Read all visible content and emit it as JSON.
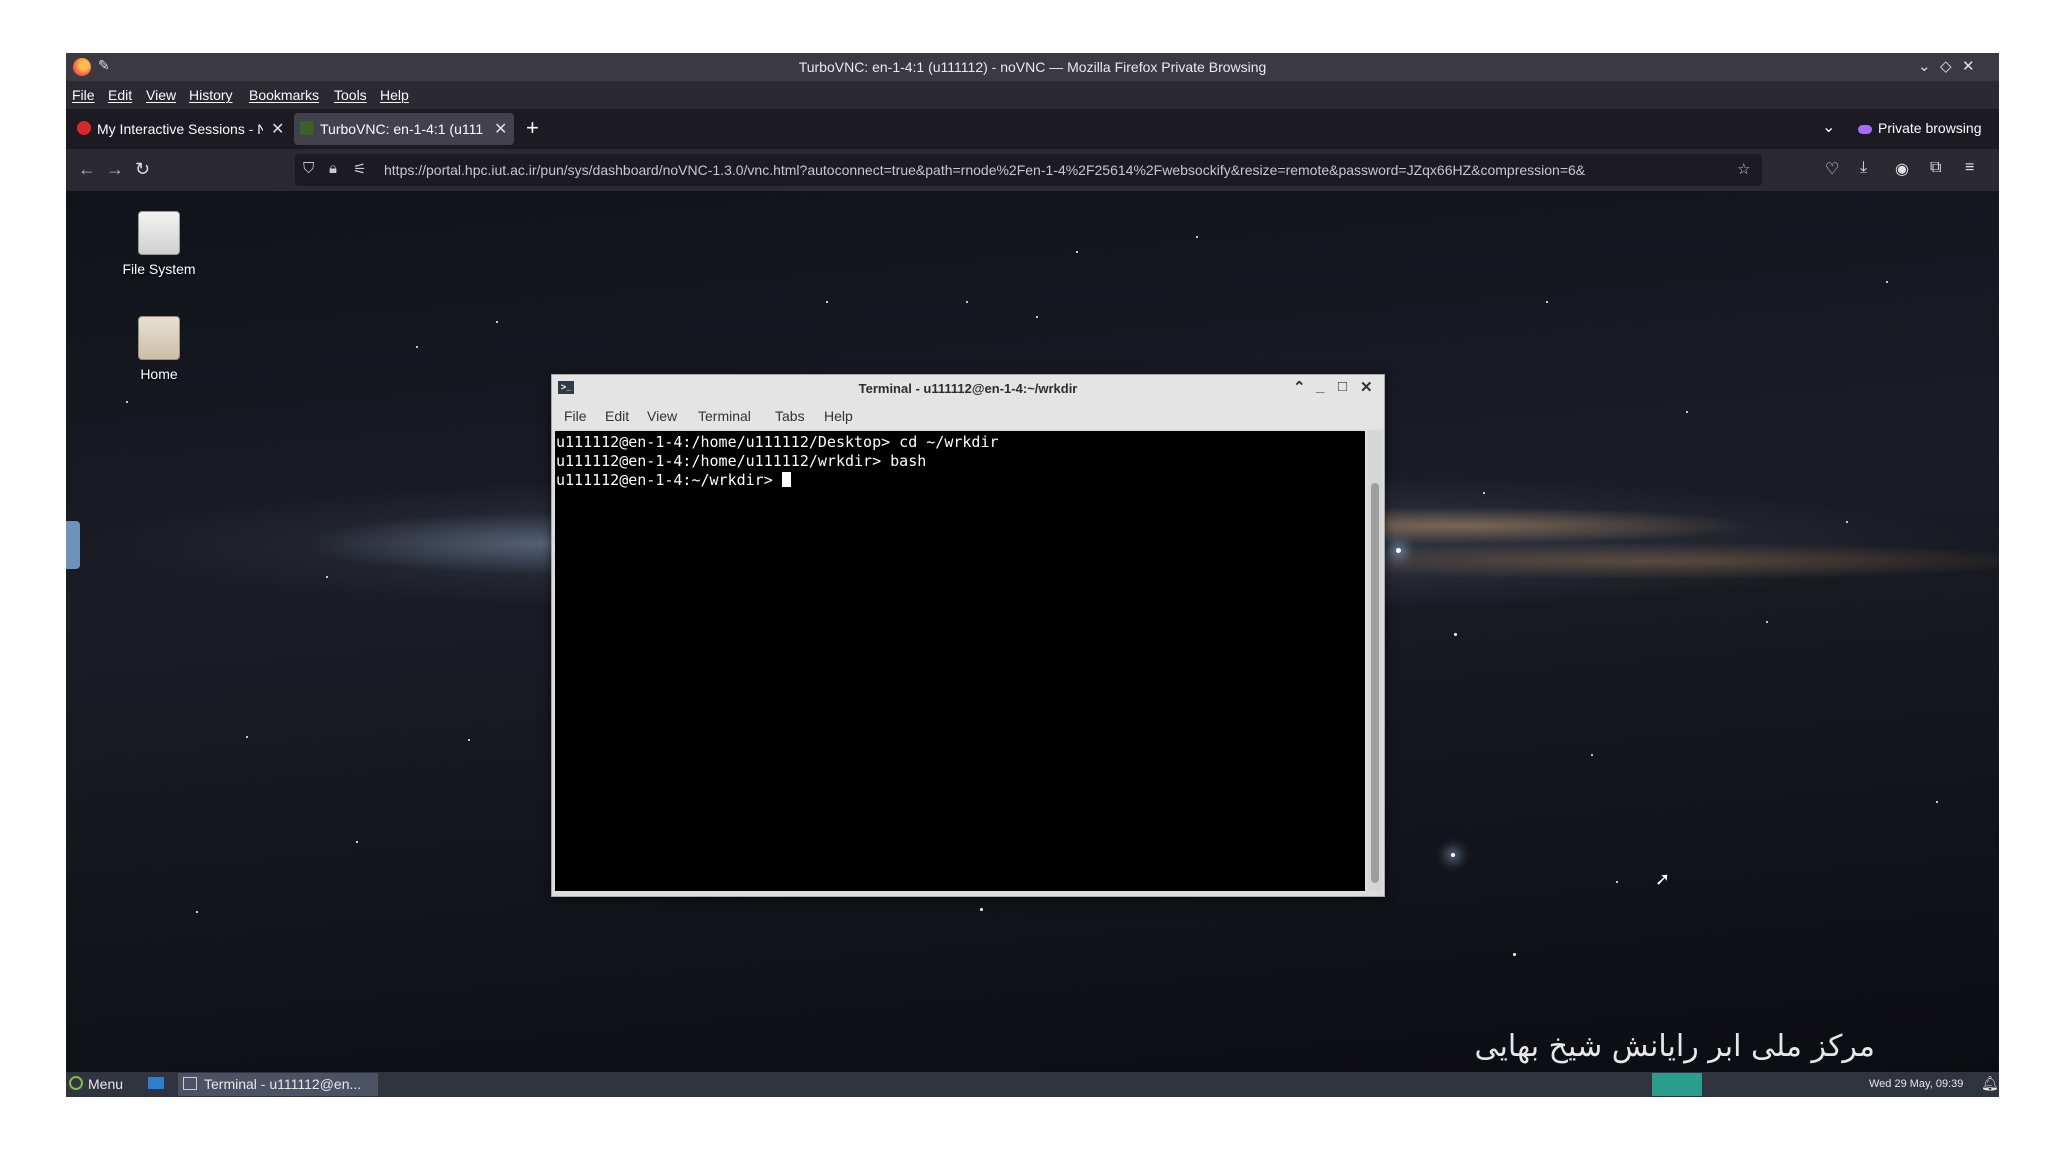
{
  "window": {
    "title": "TurboVNC: en-1-4:1 (u111112) - noVNC — Mozilla Firefox Private Browsing"
  },
  "menubar": [
    "File",
    "Edit",
    "View",
    "History",
    "Bookmarks",
    "Tools",
    "Help"
  ],
  "tabs": [
    {
      "label": "My Interactive Sessions - N",
      "active": false
    },
    {
      "label": "TurboVNC: en-1-4:1 (u111",
      "active": true
    }
  ],
  "private_label": "Private browsing",
  "urlbar": {
    "url": "https://portal.hpc.iut.ac.ir/pun/sys/dashboard/noVNC-1.3.0/vnc.html?autoconnect=true&path=rnode%2Fen-1-4%2F25614%2Fwebsockify&resize=remote&password=JZqx66HZ&compression=6&"
  },
  "desktop": {
    "icons": [
      {
        "label": "File System",
        "icon": "drive-icon"
      },
      {
        "label": "Home",
        "icon": "home-folder-icon"
      }
    ],
    "watermark": "مرکز ملی ابر رایانش شیخ بهایی"
  },
  "terminal": {
    "title": "Terminal - u111112@en-1-4:~/wrkdir",
    "menu": [
      "File",
      "Edit",
      "View",
      "Terminal",
      "Tabs",
      "Help"
    ],
    "lines": [
      "u111112@en-1-4:/home/u111112/Desktop> cd ~/wrkdir",
      "u111112@en-1-4:/home/u111112/wrkdir> bash",
      "u111112@en-1-4:~/wrkdir> "
    ]
  },
  "taskbar": {
    "menu_label": "Menu",
    "task_label": "Terminal - u111112@en...",
    "clock": "Wed 29 May, 09:39"
  },
  "colors": {
    "browser_bg": "#2b2a33",
    "tab_strip": "#1c1b22",
    "taskbar": "#2f343f",
    "workspace": "#2a9d8f"
  }
}
